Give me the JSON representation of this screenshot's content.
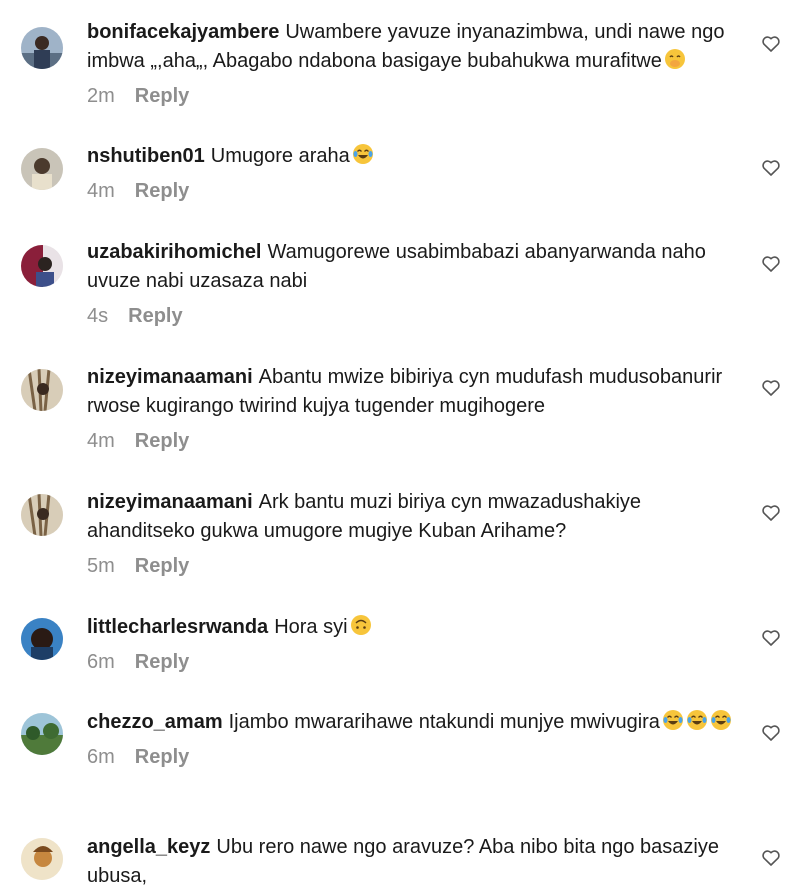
{
  "reply_label": "Reply",
  "colors": {
    "text": "#1a1a1a",
    "muted": "#8e8e8e",
    "emoji_yellow": "#f7c53b",
    "tear_blue": "#4aa3e8"
  },
  "icons": {
    "like": "heart-outline-icon"
  },
  "comments": [
    {
      "username": "bonifacekajyambere",
      "text": "Uwambere yavuze inyanazimbwa, undi nawe ngo imbwa „,aha„, Abagabo ndabona basigaye bubahukwa murafitwe",
      "emojis": [
        "face-with-hand-over-mouth"
      ],
      "time": "2m"
    },
    {
      "username": "nshutiben01",
      "text": "Umugore araha",
      "emojis": [
        "face-with-tears-of-joy"
      ],
      "time": "4m"
    },
    {
      "username": "uzabakirihomichel",
      "text": "Wamugorewe usabimbabazi abanyarwanda naho uvuze nabi uzasaza nabi",
      "emojis": [],
      "time": "4s"
    },
    {
      "username": "nizeyimanaamani",
      "text": "Abantu mwize bibiriya cyn mudufash mudusobanurir rwose kugirango twirind kujya tugender mugihogere",
      "emojis": [],
      "time": "4m"
    },
    {
      "username": "nizeyimanaamani",
      "text": "Ark bantu muzi biriya cyn mwazadushakiye ahanditseko gukwa umugore mugiye Kuban Arihame?",
      "emojis": [],
      "time": "5m"
    },
    {
      "username": "littlecharlesrwanda",
      "text": "Hora syi",
      "emojis": [
        "upside-down-face"
      ],
      "time": "6m"
    },
    {
      "username": "chezzo_amam",
      "text": "Ijambo mwararihawe ntakundi munjye mwivugira",
      "emojis": [
        "face-with-tears-of-joy",
        "face-with-tears-of-joy",
        "face-with-tears-of-joy"
      ],
      "time": "6m"
    },
    {
      "username": "angella_keyz",
      "text": "Ubu rero nawe ngo aravuze?  Aba nibo bita ngo basaziye ubusa,",
      "emojis": [],
      "time": ""
    }
  ]
}
